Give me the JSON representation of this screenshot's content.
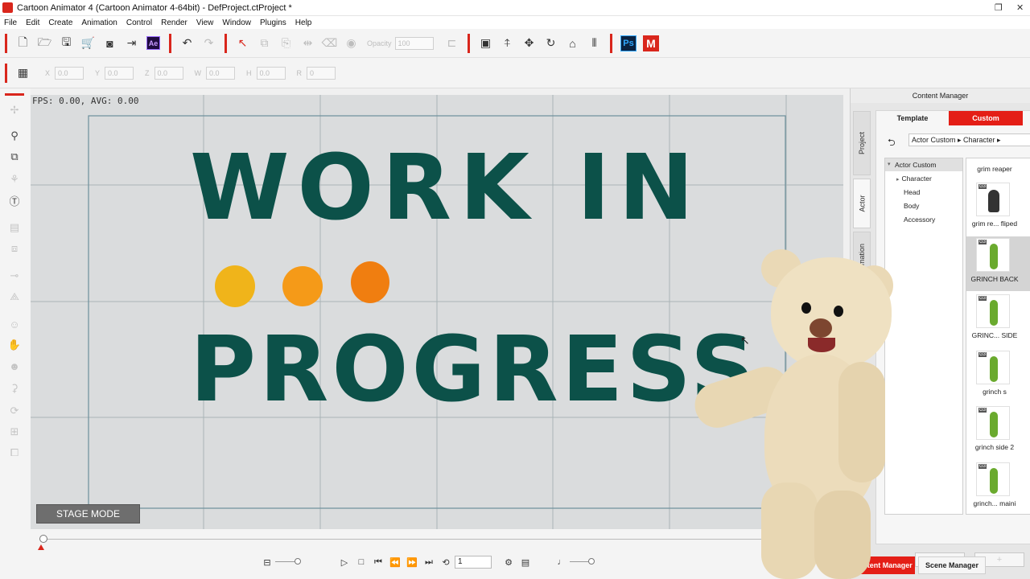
{
  "window": {
    "title": "Cartoon Animator 4  (Cartoon Animator 4-64bit) - DefProject.ctProject *",
    "restore_glyph": "❐",
    "close_glyph": "✕"
  },
  "menu": [
    "File",
    "Edit",
    "Create",
    "Animation",
    "Control",
    "Render",
    "View",
    "Window",
    "Plugins",
    "Help"
  ],
  "toolbar": {
    "icons": [
      "new-project-icon",
      "open-icon",
      "save-icon",
      "shop-icon",
      "preview-icon",
      "export-icon",
      "after-effects-icon",
      "undo-icon",
      "redo-icon",
      "select-icon",
      "copy-icon",
      "paste-icon",
      "flip-icon",
      "eraser-icon",
      "visibility-icon",
      "render-icon",
      "move-pivot-icon",
      "move-icon",
      "rotate-icon",
      "home-icon",
      "timeline-icon"
    ],
    "ae_label": "Ae",
    "opacity_label": "Opacity",
    "opacity_value": "100",
    "photoshop_label": "Ps",
    "m_label": "M"
  },
  "transform": {
    "fields": [
      {
        "label": "X",
        "value": "0.0"
      },
      {
        "label": "Y",
        "value": "0.0"
      },
      {
        "label": "Z",
        "value": "0.0"
      },
      {
        "label": "W",
        "value": "0.0"
      },
      {
        "label": "H",
        "value": "0.0"
      },
      {
        "label": "R",
        "value": "0"
      }
    ]
  },
  "viewport": {
    "fps_text": "FPS: 0.00, AVG: 0.00",
    "line1": "WORK IN",
    "line2": "PROGRESS",
    "text_color": "#0c5149",
    "dot_colors": [
      "#f0b41a",
      "#f59a18",
      "#f07e10"
    ],
    "stage_mode_label": "STAGE MODE"
  },
  "timeline": {
    "frame": "1",
    "accent": "#d9261c"
  },
  "content_manager": {
    "title": "Content Manager",
    "side_tabs": [
      "Project",
      "Actor",
      "Animation"
    ],
    "tabs": {
      "template": "Template",
      "custom": "Custom"
    },
    "path": "Actor Custom ▸ Character ▸",
    "tree": {
      "root": "Actor Custom",
      "items": [
        "Character",
        "Head",
        "Body",
        "Accessory"
      ]
    },
    "thumbnails": [
      {
        "label": "grim re... fliped",
        "badge": "G3",
        "selected": false
      },
      {
        "label": "GRINCH BACK",
        "badge": "G3",
        "selected": true
      },
      {
        "label": "GRINC... SIDE",
        "badge": "G3",
        "selected": false
      },
      {
        "label": "grinch s",
        "badge": "G3",
        "selected": false
      },
      {
        "label": "grinch side 2",
        "badge": "G3",
        "selected": false
      },
      {
        "label": "grinch... maini",
        "badge": "G3",
        "selected": false
      }
    ],
    "top_label": "grim reaper",
    "bottom_tabs": {
      "content": "Content Manager",
      "scene": "Scene Manager"
    },
    "accent": "#e41e16"
  }
}
